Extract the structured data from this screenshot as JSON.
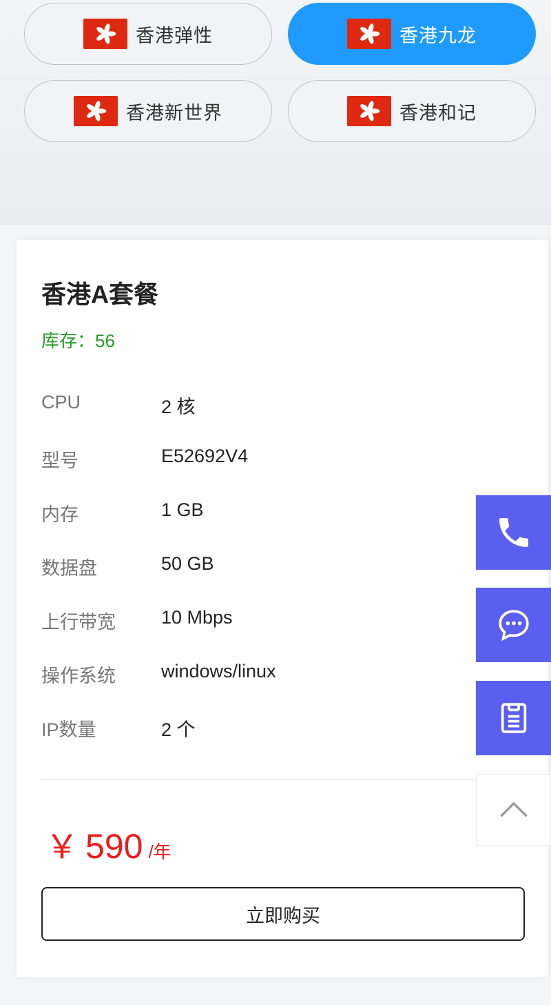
{
  "regions": [
    {
      "label": "香港弹性",
      "active": false
    },
    {
      "label": "香港九龙",
      "active": true
    },
    {
      "label": "香港新世界",
      "active": false
    },
    {
      "label": "香港和记",
      "active": false
    }
  ],
  "plan": {
    "title": "香港A套餐",
    "stock": "库存：56",
    "specs": [
      {
        "label": "CPU",
        "value": "2 核"
      },
      {
        "label": "型号",
        "value": "E52692V4"
      },
      {
        "label": "内存",
        "value": "1 GB"
      },
      {
        "label": "数据盘",
        "value": "50 GB"
      },
      {
        "label": "上行带宽",
        "value": "10 Mbps"
      },
      {
        "label": "操作系统",
        "value": "windows/linux"
      },
      {
        "label": "IP数量",
        "value": "2 个"
      }
    ],
    "price": {
      "currency": "￥",
      "amount": "590",
      "unit": "/年"
    },
    "buy_label": "立即购买"
  },
  "float_bar": {
    "icons": [
      "phone-icon",
      "chat-icon",
      "clipboard-icon",
      "chevron-up-icon"
    ],
    "accent": "#5b5ff0"
  },
  "colors": {
    "active_region": "#1f9bff",
    "flag_red": "#de2910",
    "price_red": "#ee1c1c",
    "stock_green": "#2a9a2a"
  }
}
